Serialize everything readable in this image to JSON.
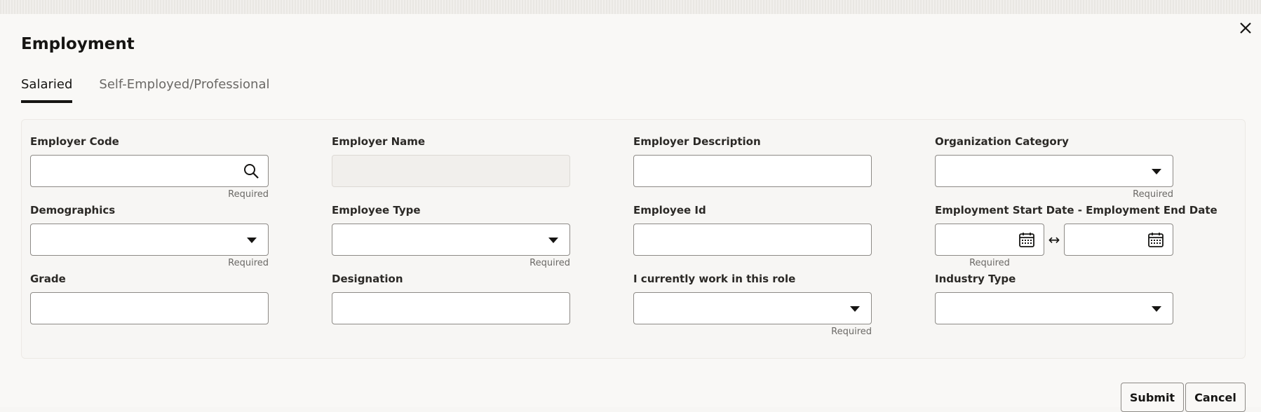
{
  "dialog": {
    "title": "Employment",
    "tabs": [
      "Salaried",
      "Self-Employed/Professional"
    ],
    "active_tab": "Salaried"
  },
  "fields": {
    "employer_code": {
      "label": "Employer Code",
      "hint": "Required",
      "value": ""
    },
    "employer_name": {
      "label": "Employer Name",
      "value": ""
    },
    "employer_description": {
      "label": "Employer Description",
      "value": ""
    },
    "organization_category": {
      "label": "Organization Category",
      "hint": "Required",
      "value": ""
    },
    "demographics": {
      "label": "Demographics",
      "hint": "Required",
      "value": ""
    },
    "employee_type": {
      "label": "Employee Type",
      "hint": "Required",
      "value": ""
    },
    "employee_id": {
      "label": "Employee Id",
      "value": ""
    },
    "employment_dates": {
      "label": "Employment Start Date - Employment End Date",
      "hint": "Required",
      "separator": "↔"
    },
    "grade": {
      "label": "Grade",
      "value": ""
    },
    "designation": {
      "label": "Designation",
      "value": ""
    },
    "currently_work": {
      "label": "I currently work in this role",
      "hint": "Required",
      "value": ""
    },
    "industry_type": {
      "label": "Industry Type",
      "value": ""
    }
  },
  "buttons": {
    "submit": "Submit",
    "cancel": "Cancel"
  },
  "icons": {
    "close": "close-icon",
    "search": "search-icon",
    "dropdown": "chevron-down-icon",
    "calendar": "calendar-icon"
  }
}
